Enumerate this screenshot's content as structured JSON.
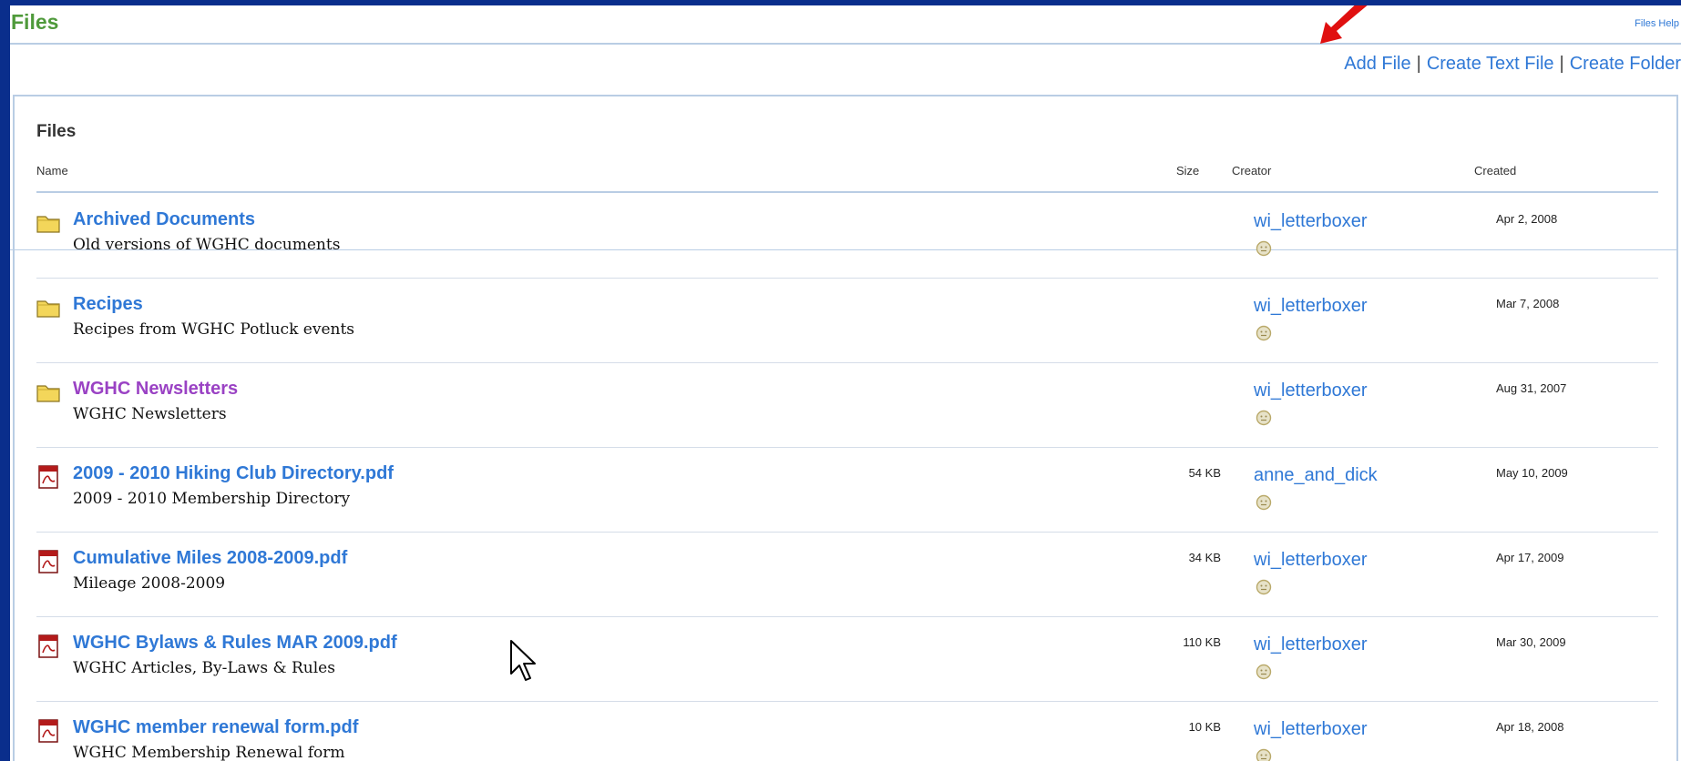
{
  "page": {
    "title": "Files",
    "help_link": "Files Help"
  },
  "actions": {
    "add_file": "Add File",
    "create_text_file": "Create Text File",
    "create_folder": "Create Folder",
    "separator": "|"
  },
  "list": {
    "section_title": "Files",
    "columns": {
      "name": "Name",
      "size": "Size",
      "creator": "Creator",
      "created": "Created"
    },
    "rows": [
      {
        "type": "folder",
        "name": "Archived Documents",
        "description": "Old versions of WGHC documents",
        "size": "",
        "creator": "wi_letterboxer",
        "created": "Apr 2, 2008",
        "visited": false
      },
      {
        "type": "folder",
        "name": "Recipes",
        "description": "Recipes from WGHC Potluck events",
        "size": "",
        "creator": "wi_letterboxer",
        "created": "Mar 7, 2008",
        "visited": false
      },
      {
        "type": "folder",
        "name": "WGHC Newsletters",
        "description": "WGHC Newsletters",
        "size": "",
        "creator": "wi_letterboxer",
        "created": "Aug 31, 2007",
        "visited": true
      },
      {
        "type": "pdf",
        "name": "2009 - 2010 Hiking Club Directory.pdf",
        "description": "2009 - 2010 Membership Directory",
        "size": "54 KB",
        "creator": "anne_and_dick",
        "created": "May 10, 2009",
        "visited": false
      },
      {
        "type": "pdf",
        "name": "Cumulative Miles 2008-2009.pdf",
        "description": "Mileage 2008-2009",
        "size": "34 KB",
        "creator": "wi_letterboxer",
        "created": "Apr 17, 2009",
        "visited": false
      },
      {
        "type": "pdf",
        "name": "WGHC Bylaws & Rules MAR 2009.pdf",
        "description": "WGHC Articles, By-Laws & Rules",
        "size": "110 KB",
        "creator": "wi_letterboxer",
        "created": "Mar 30, 2009",
        "visited": false
      },
      {
        "type": "pdf",
        "name": "WGHC member renewal form.pdf",
        "description": "WGHC Membership Renewal form",
        "size": "10 KB",
        "creator": "wi_letterboxer",
        "created": "Apr 18, 2008",
        "visited": false
      }
    ]
  },
  "icons": {
    "folder": "folder-icon",
    "pdf": "pdf-file-icon",
    "status": "offline-status-icon",
    "arrow": "red-arrow-icon",
    "cursor": "mouse-cursor-icon"
  },
  "colors": {
    "frame": "#0a2e8c",
    "title": "#4f9a3b",
    "link": "#2f78d6",
    "visited_link": "#9a42c4",
    "arrow": "#e01010"
  }
}
